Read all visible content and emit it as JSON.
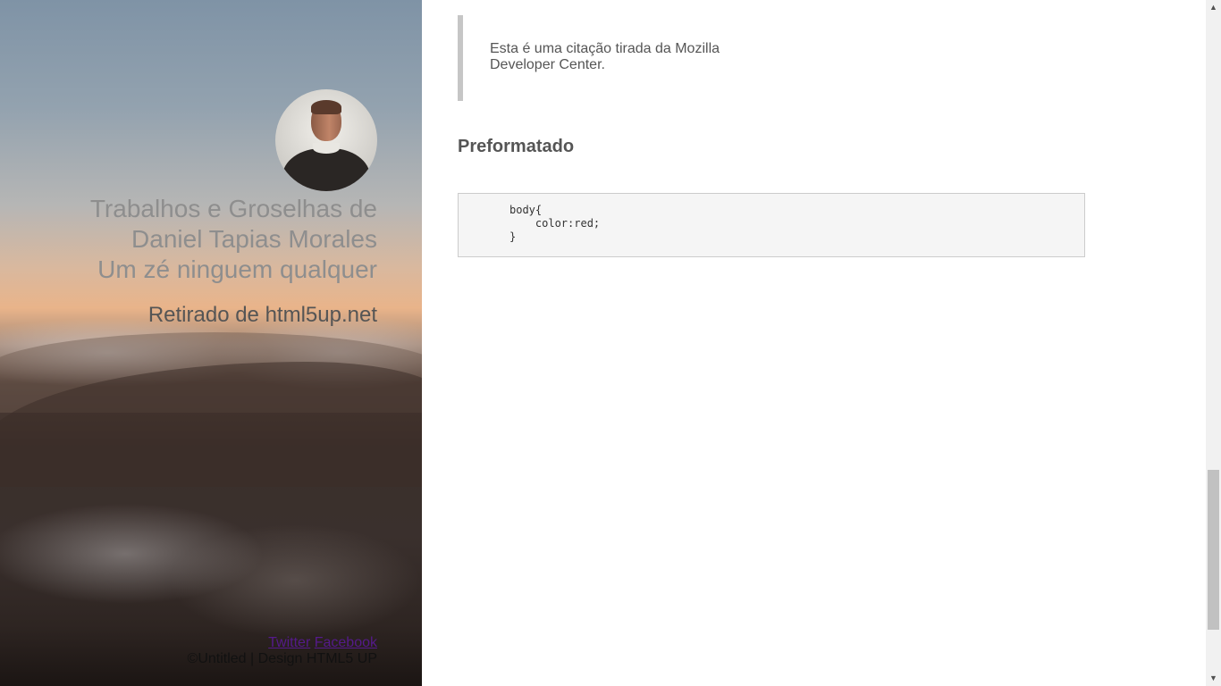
{
  "sidebar": {
    "title_lines": [
      "Trabalhos e Groselhas de",
      "Daniel Tapias Morales",
      "Um zé ninguem qualquer"
    ],
    "subtitle": "Retirado de html5up.net",
    "links": [
      {
        "label": "Twitter"
      },
      {
        "label": "Facebook"
      }
    ],
    "credits": "©Untitled | Design HTML5 UP"
  },
  "main": {
    "blockquote": "Esta é uma citação tirada da Mozilla Developer Center.",
    "preformatted_heading": "Preformatado",
    "code": "body{\n    color:red;\n}"
  },
  "scrollbar": {
    "up_icon": "▲",
    "down_icon": "▼"
  }
}
